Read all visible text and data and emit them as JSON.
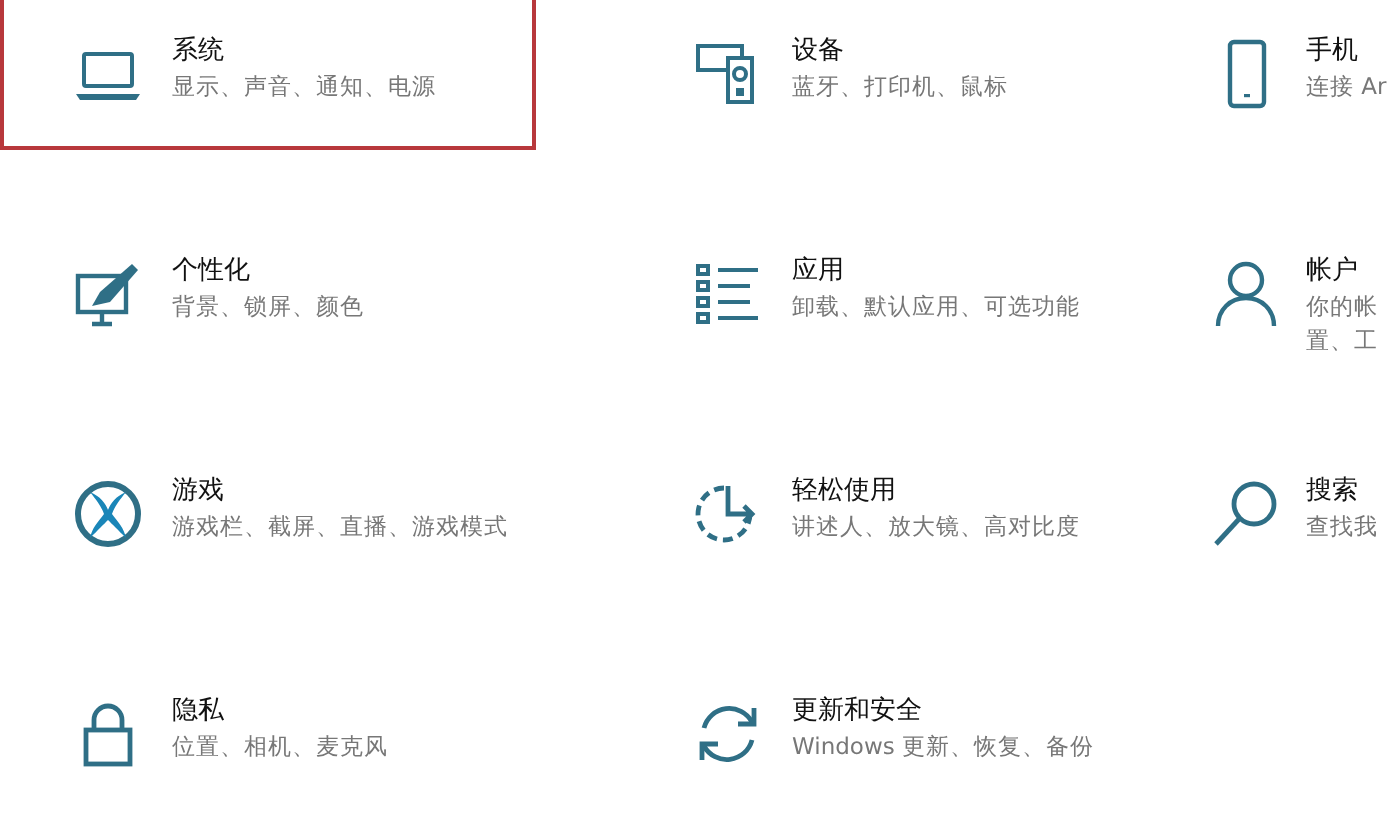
{
  "categories": [
    {
      "kind": "laptop",
      "title": "系统",
      "subtitle": [
        "显示、声音、通知、电源"
      ],
      "selected": true
    },
    {
      "kind": "devices",
      "title": "设备",
      "subtitle": [
        "蓝牙、打印机、鼠标"
      ],
      "selected": false
    },
    {
      "kind": "phone",
      "title": "手机",
      "subtitle": [
        "连接 Ar"
      ],
      "selected": false
    },
    {
      "kind": "personalize",
      "title": "个性化",
      "subtitle": [
        "背景、锁屏、颜色"
      ],
      "selected": false
    },
    {
      "kind": "apps",
      "title": "应用",
      "subtitle": [
        "卸载、默认应用、可选功能"
      ],
      "selected": false
    },
    {
      "kind": "account",
      "title": "帐户",
      "subtitle": [
        "你的帐",
        "置、工"
      ],
      "selected": false
    },
    {
      "kind": "gaming",
      "title": "游戏",
      "subtitle": [
        "游戏栏、截屏、直播、游戏模式"
      ],
      "selected": false
    },
    {
      "kind": "ease",
      "title": "轻松使用",
      "subtitle": [
        "讲述人、放大镜、高对比度"
      ],
      "selected": false
    },
    {
      "kind": "search",
      "title": "搜索",
      "subtitle": [
        "查找我"
      ],
      "selected": false
    },
    {
      "kind": "privacy",
      "title": "隐私",
      "subtitle": [
        "位置、相机、麦克风"
      ],
      "selected": false
    },
    {
      "kind": "update",
      "title": "更新和安全",
      "subtitle": [
        "Windows 更新、恢复、备份"
      ],
      "selected": false
    }
  ]
}
